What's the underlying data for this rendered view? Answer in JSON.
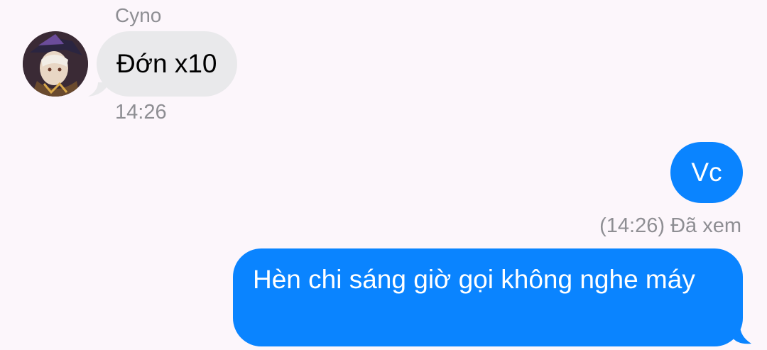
{
  "conversation": {
    "incoming": {
      "sender": "Cyno",
      "avatar_icon": "user-avatar-icon",
      "message": "Đớn x10",
      "time": "14:26",
      "bubble_color": "#e9e9eb"
    },
    "outgoing": [
      {
        "message": "Vc"
      },
      {
        "message": "Hèn chi sáng giờ gọi không nghe máy"
      }
    ],
    "read_receipt": "(14:26) Đã xem",
    "outgoing_bubble_color": "#0a84ff",
    "background_color": "#fcf6fb"
  }
}
